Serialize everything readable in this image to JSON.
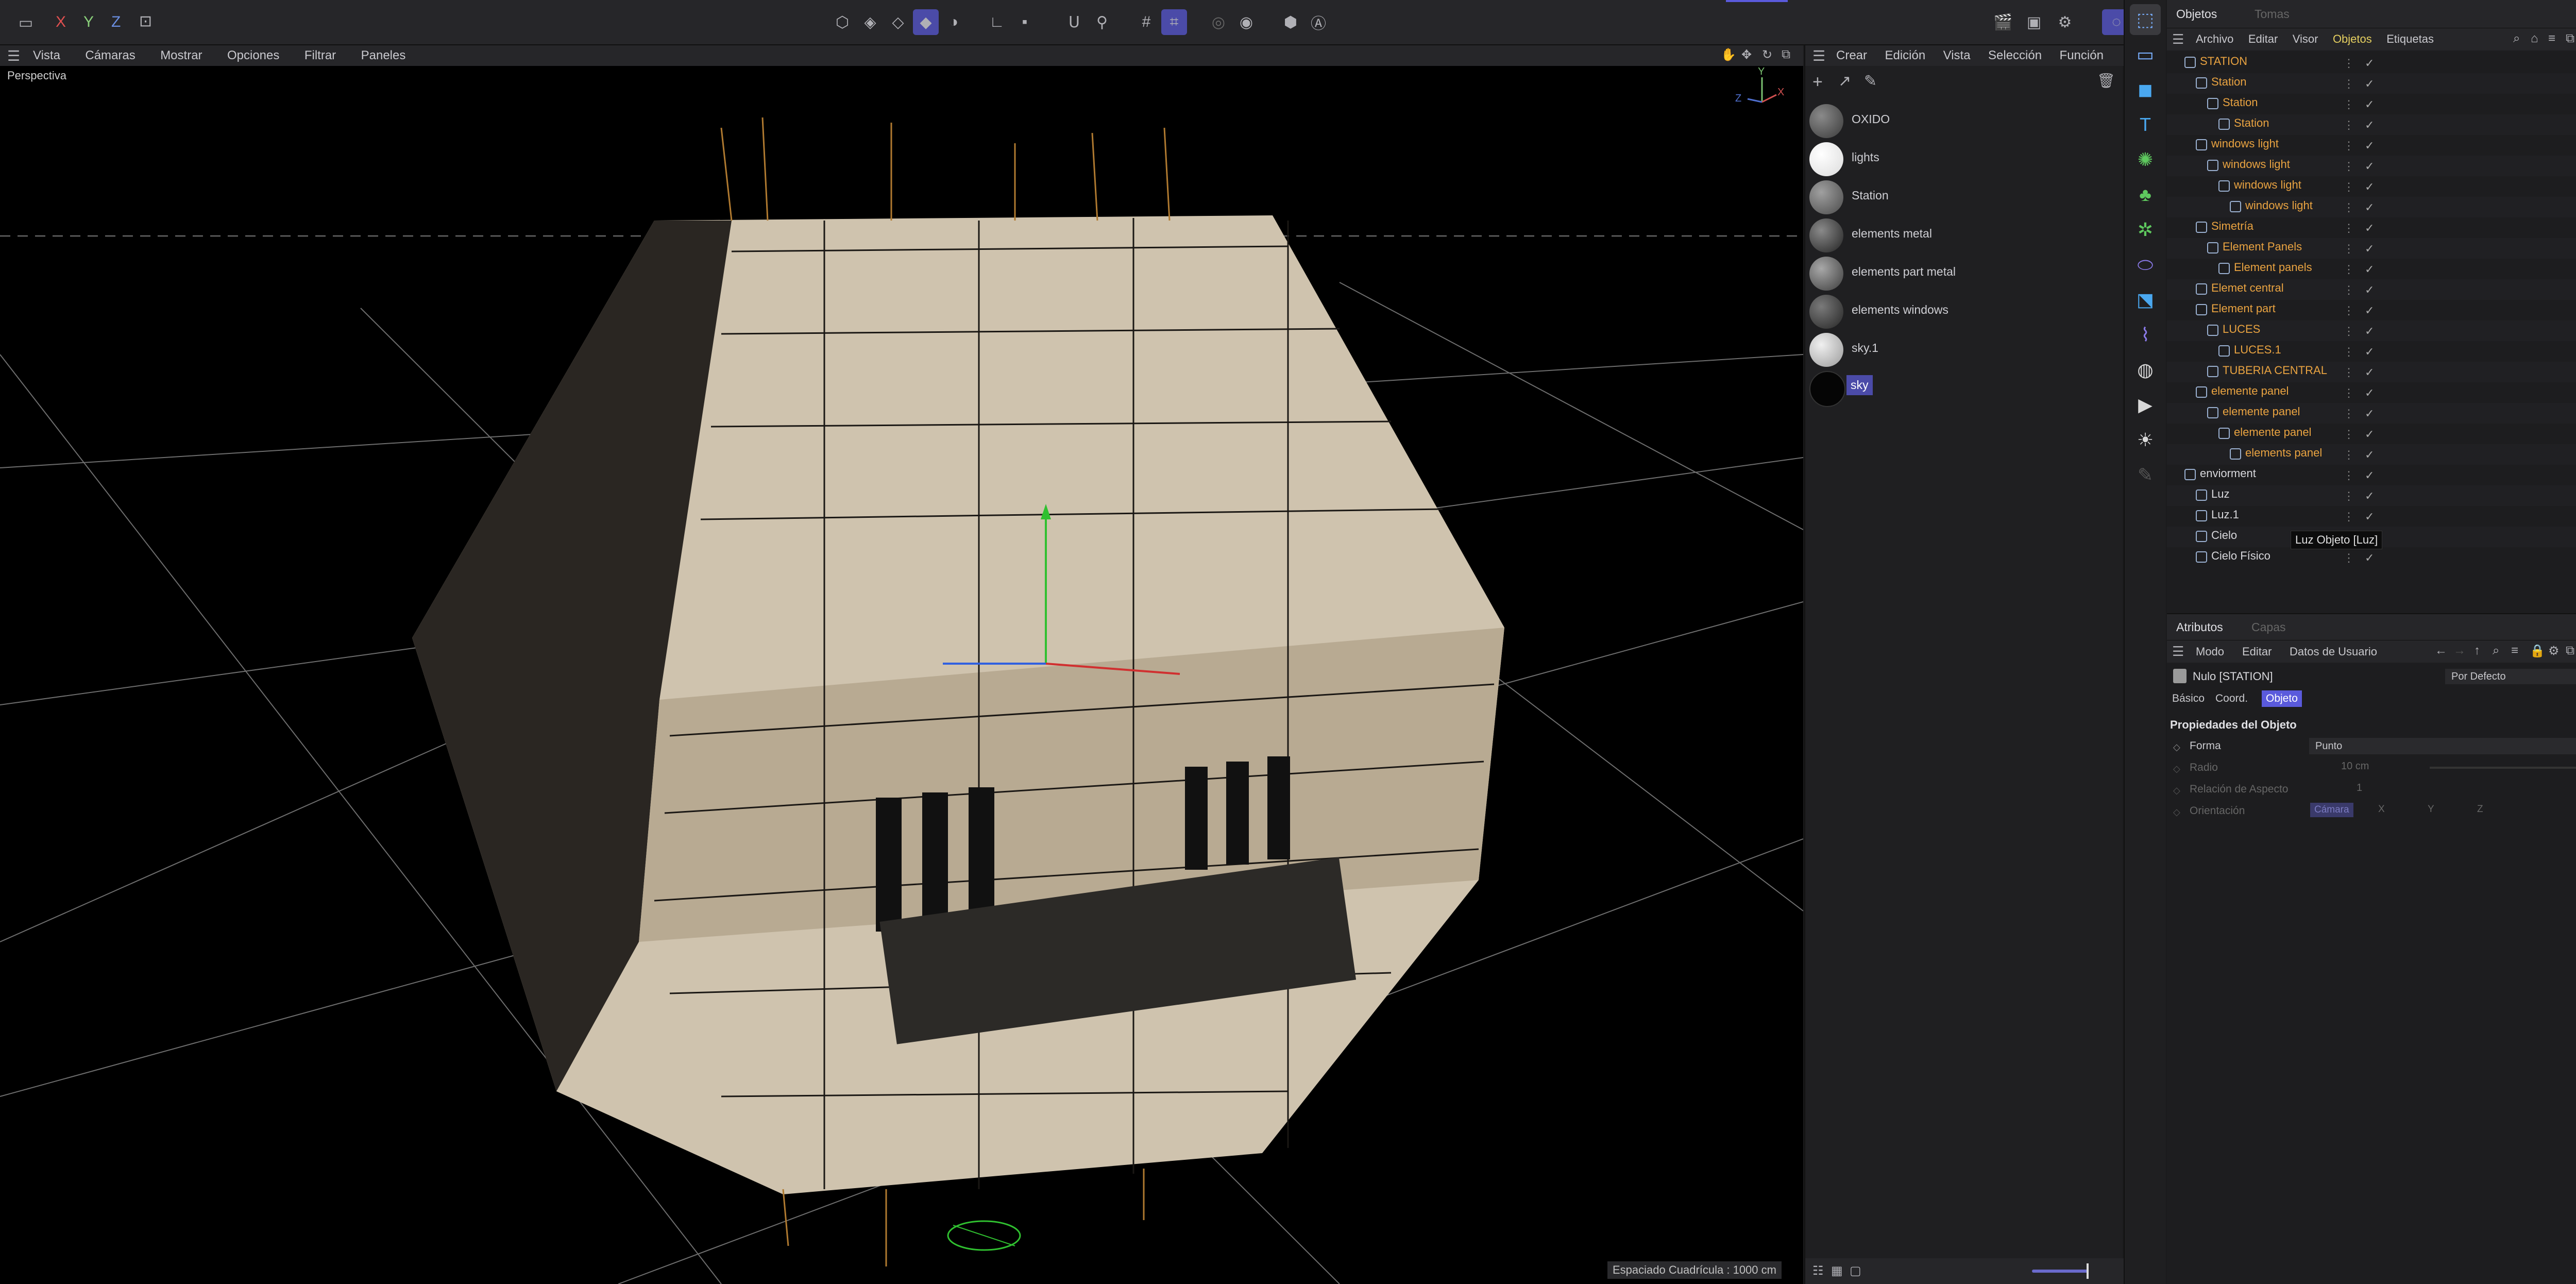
{
  "top_toolbar": {
    "axis_x": "X",
    "axis_y": "Y",
    "axis_z": "Z",
    "icons": [
      "layout-icon",
      "lock-icon",
      "model-mode-icon",
      "object-mode-icon",
      "point-mode-icon",
      "edge-mode-icon",
      "poly-mode-icon",
      "uv-mode-icon",
      "axis-icon",
      "snap-icon",
      "magnet-icon",
      "workplane-icon",
      "grid-snap-icon",
      "quantize-icon",
      "render-view-icon",
      "render-icon",
      "render-settings-icon",
      "interactive-render-icon"
    ]
  },
  "viewport": {
    "menu": [
      "Vista",
      "Cámaras",
      "Mostrar",
      "Opciones",
      "Filtrar",
      "Paneles"
    ],
    "label": "Perspectiva",
    "grid_status": "Espaciado Cuadrícula : 1000 cm",
    "axis_labels": {
      "y": "Y",
      "z": "Z",
      "x": "X"
    }
  },
  "materials": {
    "menu": [
      "Crear",
      "Edición",
      "Vista",
      "Selección",
      "Función"
    ],
    "items": [
      {
        "name": "OXIDO",
        "color": "#4a4a4a"
      },
      {
        "name": "lights",
        "color": "#f2f2f2"
      },
      {
        "name": "Station",
        "color": "#5c5c5c"
      },
      {
        "name": "elements metal",
        "color": "#3a3a3a"
      },
      {
        "name": "elements part metal",
        "color": "#545454"
      },
      {
        "name": "elements windows",
        "color": "#404040"
      },
      {
        "name": "sky.1",
        "color": "#cfcfcf"
      },
      {
        "name": "sky",
        "color": "#0a0a0a"
      }
    ],
    "selected": "sky"
  },
  "objects_panel": {
    "tabs": [
      "Objetos",
      "Tomas"
    ],
    "menu": [
      "Archivo",
      "Editar",
      "Visor",
      "Objetos",
      "Etiquetas"
    ],
    "active_menu": "Objetos",
    "tree": [
      {
        "label": "STATION",
        "indent": 0,
        "color": "orange"
      },
      {
        "label": "Station",
        "indent": 1,
        "color": "orange"
      },
      {
        "label": "Station",
        "indent": 2,
        "color": "orange"
      },
      {
        "label": "Station",
        "indent": 3,
        "color": "orange"
      },
      {
        "label": "windows light",
        "indent": 1,
        "color": "orange"
      },
      {
        "label": "windows light",
        "indent": 2,
        "color": "orange"
      },
      {
        "label": "windows light",
        "indent": 3,
        "color": "orange"
      },
      {
        "label": "windows light",
        "indent": 4,
        "color": "orange"
      },
      {
        "label": "Simetría",
        "indent": 1,
        "color": "orange"
      },
      {
        "label": "Element Panels",
        "indent": 2,
        "color": "orange"
      },
      {
        "label": "Element panels",
        "indent": 3,
        "color": "orange"
      },
      {
        "label": "Elemet central",
        "indent": 1,
        "color": "orange"
      },
      {
        "label": "Element part",
        "indent": 1,
        "color": "orange"
      },
      {
        "label": "LUCES",
        "indent": 2,
        "color": "orange"
      },
      {
        "label": "LUCES.1",
        "indent": 3,
        "color": "orange"
      },
      {
        "label": "TUBERIA CENTRAL",
        "indent": 2,
        "color": "orange"
      },
      {
        "label": "elemente panel",
        "indent": 1,
        "color": "orange"
      },
      {
        "label": "elemente panel",
        "indent": 2,
        "color": "orange"
      },
      {
        "label": "elemente panel",
        "indent": 3,
        "color": "orange"
      },
      {
        "label": "elements panel",
        "indent": 4,
        "color": "orange"
      },
      {
        "label": "enviorment",
        "indent": 0,
        "color": "white"
      },
      {
        "label": "Luz",
        "indent": 1,
        "color": "white"
      },
      {
        "label": "Luz.1",
        "indent": 1,
        "color": "white"
      },
      {
        "label": "Cielo",
        "indent": 1,
        "color": "white"
      },
      {
        "label": "Cielo Físico",
        "indent": 1,
        "color": "white"
      }
    ],
    "tooltip": "Luz Objeto [Luz]"
  },
  "attributes": {
    "tabs": [
      "Atributos",
      "Capas"
    ],
    "menu": [
      "Modo",
      "Editar",
      "Datos de Usuario"
    ],
    "object_title": "Nulo [STATION]",
    "preset": "Por Defecto",
    "subtabs": [
      "Básico",
      "Coord.",
      "Objeto"
    ],
    "active_subtab": "Objeto",
    "section": "Propiedades del Objeto",
    "forma_label": "Forma",
    "forma_value": "Punto",
    "radio_label": "Radio",
    "radio_value": "10 cm",
    "aspect_label": "Relación de Aspecto",
    "aspect_value": "1",
    "orient_label": "Orientación",
    "orient_options": [
      "Cámara",
      "X",
      "Y",
      "Z"
    ]
  },
  "colors": {
    "accent": "#5a5adc",
    "orange_text": "#e9a341",
    "selection": "#4b4ba8"
  }
}
